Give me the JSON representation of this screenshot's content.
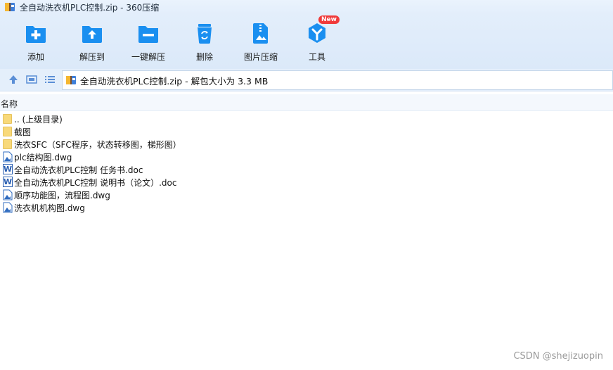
{
  "window": {
    "title": "全自动洗衣机PLC控制.zip - 360压缩"
  },
  "toolbar": {
    "items": [
      {
        "label": "添加",
        "icon": "add-icon"
      },
      {
        "label": "解压到",
        "icon": "extract-to-icon"
      },
      {
        "label": "一键解压",
        "icon": "one-click-extract-icon"
      },
      {
        "label": "删除",
        "icon": "delete-icon"
      },
      {
        "label": "图片压缩",
        "icon": "image-compress-icon"
      },
      {
        "label": "工具",
        "icon": "tools-icon",
        "badge": "New"
      }
    ],
    "accent": "#1a8ff0"
  },
  "addressbar": {
    "path": "全自动洗衣机PLC控制.zip - 解包大小为 3.3 MB"
  },
  "filelist": {
    "column_name": "名称",
    "items": [
      {
        "name": ".. (上级目录)",
        "type": "folder"
      },
      {
        "name": "截图",
        "type": "folder"
      },
      {
        "name": "洗衣SFC（SFC程序，状态转移图，梯形图）",
        "type": "folder"
      },
      {
        "name": "plc结构图.dwg",
        "type": "dwg"
      },
      {
        "name": "全自动洗衣机PLC控制 任务书.doc",
        "type": "doc"
      },
      {
        "name": "全自动洗衣机PLC控制 说明书（论文）.doc",
        "type": "doc"
      },
      {
        "name": "顺序功能图，流程图.dwg",
        "type": "dwg"
      },
      {
        "name": "洗衣机机构图.dwg",
        "type": "dwg"
      }
    ]
  },
  "watermark": "CSDN @shejizuopin"
}
